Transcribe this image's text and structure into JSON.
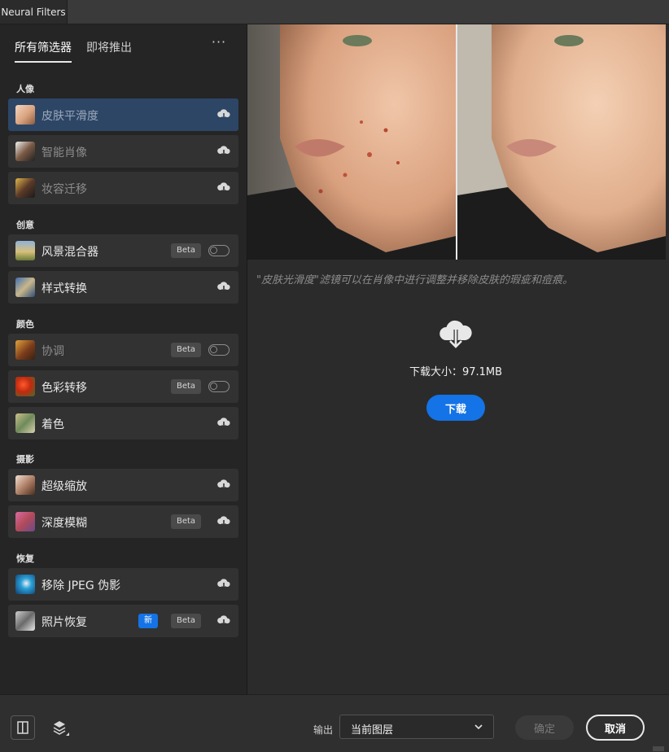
{
  "window": {
    "tab_title": "Neural Filters"
  },
  "sidebar": {
    "tabs": [
      {
        "label": "所有筛选器",
        "active": true
      },
      {
        "label": "即将推出",
        "active": false
      }
    ],
    "more_label": "···",
    "sections": [
      {
        "title": "人像",
        "items": [
          {
            "label": "皮肤平滑度",
            "state": "selected",
            "action": "download"
          },
          {
            "label": "智能肖像",
            "state": "disabled",
            "action": "download"
          },
          {
            "label": "妆容迁移",
            "state": "disabled",
            "action": "download"
          }
        ]
      },
      {
        "title": "创意",
        "items": [
          {
            "label": "风景混合器",
            "badge": "Beta",
            "action": "toggle",
            "toggle_on": false
          },
          {
            "label": "样式转换",
            "action": "download"
          }
        ]
      },
      {
        "title": "颜色",
        "items": [
          {
            "label": "协调",
            "state": "disabled",
            "badge": "Beta",
            "action": "toggle",
            "toggle_on": false
          },
          {
            "label": "色彩转移",
            "badge": "Beta",
            "action": "toggle",
            "toggle_on": false
          },
          {
            "label": "着色",
            "action": "download"
          }
        ]
      },
      {
        "title": "摄影",
        "items": [
          {
            "label": "超级缩放",
            "action": "download"
          },
          {
            "label": "深度模糊",
            "badge": "Beta",
            "action": "download"
          }
        ]
      },
      {
        "title": "恢复",
        "items": [
          {
            "label": "移除 JPEG 伪影",
            "action": "download"
          },
          {
            "label": "照片恢复",
            "new_badge": "新",
            "badge": "Beta",
            "action": "download"
          }
        ]
      }
    ]
  },
  "main": {
    "description": "\"皮肤光滑度\"滤镜可以在肖像中进行调整并移除皮肤的瑕疵和痘痕。",
    "download_size": "下载大小：97.1MB",
    "download_button": "下载"
  },
  "footer": {
    "output_label": "输出",
    "output_value": "当前图层",
    "ok_label": "确定",
    "cancel_label": "取消"
  },
  "colors": {
    "accent": "#1473e6",
    "selected_row": "#2d4666"
  }
}
